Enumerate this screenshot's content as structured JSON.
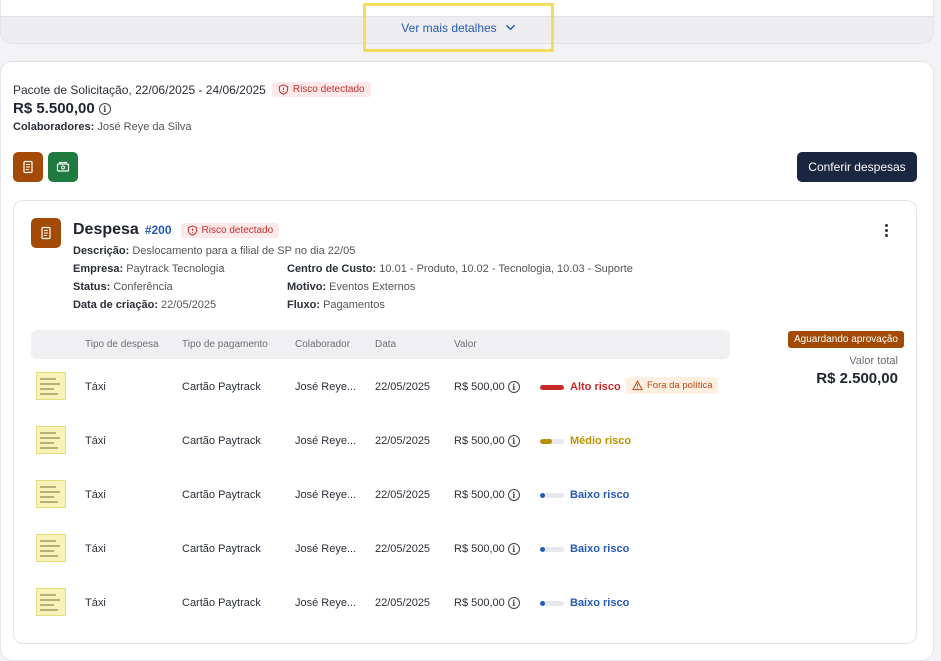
{
  "top_card": {
    "more_details_label": "Ver mais detalhes"
  },
  "package": {
    "title": "Pacote de Solicitação, 22/06/2025 - 24/06/2025",
    "risk_badge": "Risco detectado",
    "amount": "R$ 5.500,00",
    "collaborators_label": "Colaboradores:",
    "collaborators_value": "José Reye da Silva",
    "check_expenses_label": "Conferir despesas"
  },
  "expense": {
    "title": "Despesa",
    "id": "#200",
    "risk_badge": "Risco detectado",
    "description_label": "Descrição:",
    "description_value": "Deslocamento para a filial de SP no dia 22/05",
    "company_label": "Empresa:",
    "company_value": "Paytrack Tecnologia",
    "cost_center_label": "Centro de Custo:",
    "cost_center_value": "10.01 - Produto, 10.02 - Tecnologia, 10.03 - Suporte",
    "status_label": "Status:",
    "status_value": "Conferência",
    "reason_label": "Motivo:",
    "reason_value": "Eventos Externos",
    "created_label": "Data de criação:",
    "created_value": "22/05/2025",
    "flow_label": "Fluxo:",
    "flow_value": "Pagamentos",
    "status_badge": "Aguardando aprovação",
    "total_label": "Valor total",
    "total_value": "R$ 2.500,00"
  },
  "table": {
    "headers": [
      "Tipo de despesa",
      "Tipo de pagamento",
      "Colaborador",
      "Data",
      "Valor"
    ],
    "rows": [
      {
        "type": "Táxi",
        "payment": "Cartão Paytrack",
        "collaborator": "José Reye...",
        "date": "22/05/2025",
        "value": "R$ 500,00",
        "risk": "Alto risco",
        "risk_level": 1.0,
        "risk_color": "#c62828",
        "policy": "Fora da política"
      },
      {
        "type": "Táxi",
        "payment": "Cartão Paytrack",
        "collaborator": "José Reye...",
        "date": "22/05/2025",
        "value": "R$ 500,00",
        "risk": "Médio risco",
        "risk_level": 0.5,
        "risk_color": "#b89200"
      },
      {
        "type": "Táxi",
        "payment": "Cartão Paytrack",
        "collaborator": "José Reye...",
        "date": "22/05/2025",
        "value": "R$ 500,00",
        "risk": "Baixo risco",
        "risk_level": 0.2,
        "risk_color": "#2459b8"
      },
      {
        "type": "Táxi",
        "payment": "Cartão Paytrack",
        "collaborator": "José Reye...",
        "date": "22/05/2025",
        "value": "R$ 500,00",
        "risk": "Baixo risco",
        "risk_level": 0.2,
        "risk_color": "#2459b8"
      },
      {
        "type": "Táxi",
        "payment": "Cartão Paytrack",
        "collaborator": "José Reye...",
        "date": "22/05/2025",
        "value": "R$ 500,00",
        "risk": "Baixo risco",
        "risk_level": 0.2,
        "risk_color": "#2459b8"
      }
    ]
  }
}
